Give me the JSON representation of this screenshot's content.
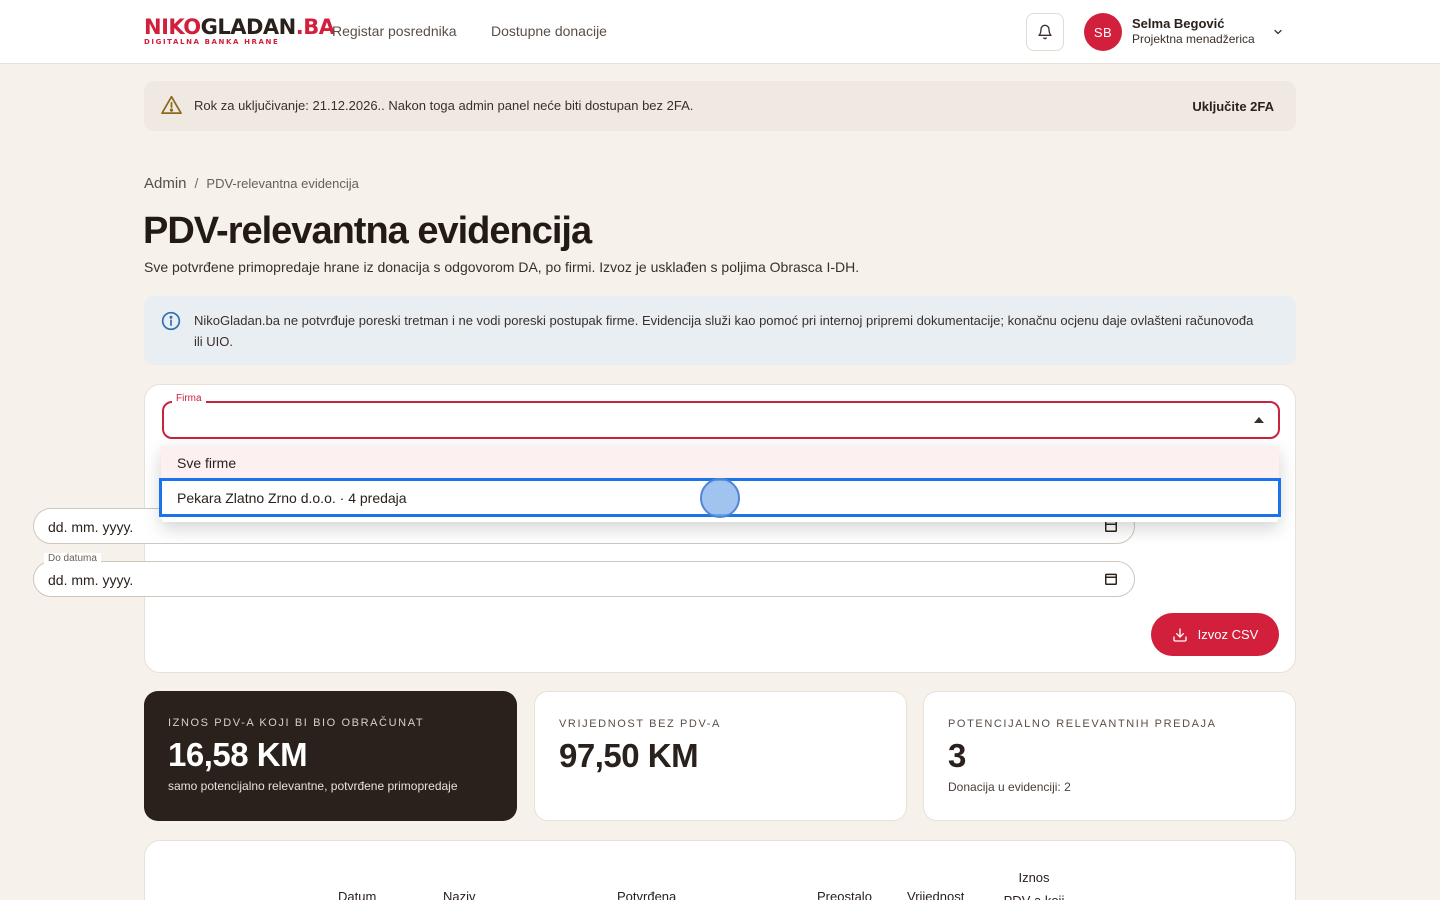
{
  "header": {
    "logo_main_red": "NIKO",
    "logo_main_dark": "GLADAN",
    "logo_main_red2": ".BA",
    "logo_sub": "DIGITALNA BANKA HRANE",
    "nav": [
      "Registar posrednika",
      "Dostupne donacije"
    ],
    "user": {
      "initials": "SB",
      "name": "Selma Begović",
      "role": "Projektna menadžerica"
    }
  },
  "warning": {
    "text": "Rok za uključivanje: 21.12.2026.. Nakon toga admin panel neće biti dostupan bez 2FA.",
    "action": "Uključite 2FA"
  },
  "breadcrumb": {
    "root": "Admin",
    "separator": "/",
    "current": "PDV-relevantna evidencija"
  },
  "page": {
    "title": "PDV-relevantna evidencija",
    "subtitle": "Sve potvrđene primopredaje hrane iz donacija s odgovorom DA, po firmi. Izvoz je usklađen s poljima Obrasca I-DH."
  },
  "info": {
    "text": "NikoGladan.ba ne potvrđuje poreski tretman i ne vodi poreski postupak firme. Evidencija služi kao pomoć pri internoj pripremi dokumentacije; konačnu ocjenu daje ovlašteni računovođa ili UIO."
  },
  "filters": {
    "firma_label": "Firma",
    "firma_value": "",
    "options": [
      "Sve firme",
      "Pekara Zlatno Zrno d.o.o. · 4 predaja"
    ],
    "date_from_value": "dd. mm. yyyy.",
    "date_to_label": "Do datuma",
    "date_to_value": "dd. mm. yyyy.",
    "export_label": "Izvoz CSV"
  },
  "stats": [
    {
      "label": "IZNOS PDV-A KOJI BI BIO OBRAČUNAT",
      "value": "16,58 KM",
      "note": "samo potencijalno relevantne, potvrđene primopredaje"
    },
    {
      "label": "VRIJEDNOST BEZ PDV-A",
      "value": "97,50 KM",
      "note": ""
    },
    {
      "label": "POTENCIJALNO RELEVANTNIH PREDAJA",
      "value": "3",
      "note": "Donacija u evidenciji: 2"
    }
  ],
  "table": {
    "headers": [
      "Datum",
      "Naziv",
      "Potvrđena",
      "Preostalo",
      "Vrijednost",
      "Iznos PDV-a koji"
    ]
  },
  "colors": {
    "accent": "#d21f3c",
    "dark_card": "#2a211d",
    "page_bg": "#f6f1ea",
    "focus": "#1a73e8"
  }
}
